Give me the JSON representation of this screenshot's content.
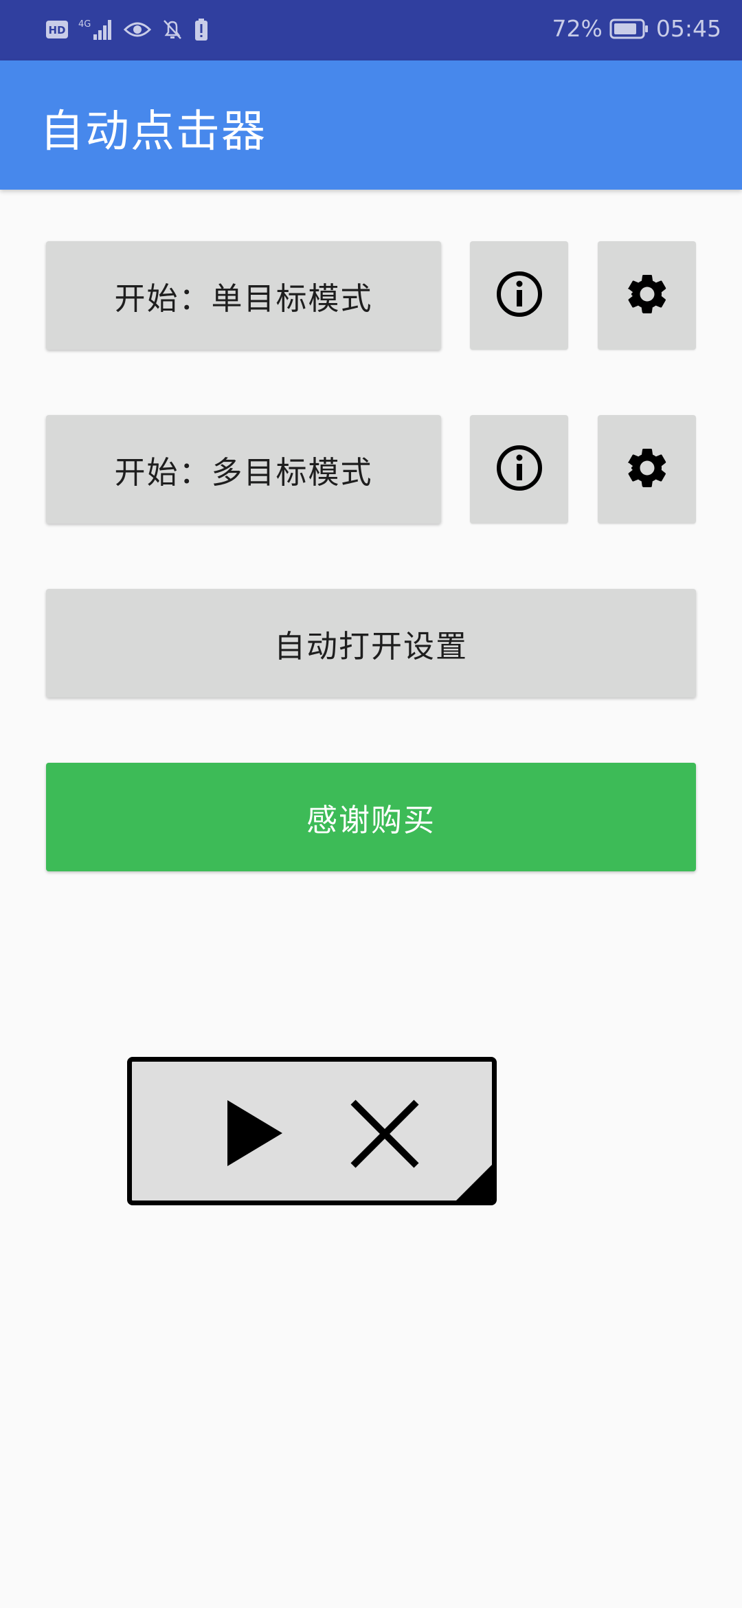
{
  "status_bar": {
    "hd": "HD",
    "network": "4G",
    "battery_percent": "72%",
    "time": "05:45",
    "icons": [
      "hd-icon",
      "signal-icon",
      "eye-icon",
      "bell-off-icon",
      "battery-alert-icon",
      "battery-icon"
    ]
  },
  "app_bar": {
    "title": "自动点击器"
  },
  "single_mode": {
    "start_label": "开始：单目标模式",
    "info_icon": "info-icon",
    "settings_icon": "gear-icon"
  },
  "multi_mode": {
    "start_label": "开始：多目标模式",
    "info_icon": "info-icon",
    "settings_icon": "gear-icon"
  },
  "auto_open_settings_label": "自动打开设置",
  "thanks_label": "感谢购买",
  "floating_controls": {
    "play_icon": "play-icon",
    "close_icon": "close-icon"
  },
  "colors": {
    "status_bar": "#303f9f",
    "app_bar": "#4788ec",
    "button_grey": "#d8d9d8",
    "button_green": "#3dbb57",
    "background": "#fafafa"
  }
}
